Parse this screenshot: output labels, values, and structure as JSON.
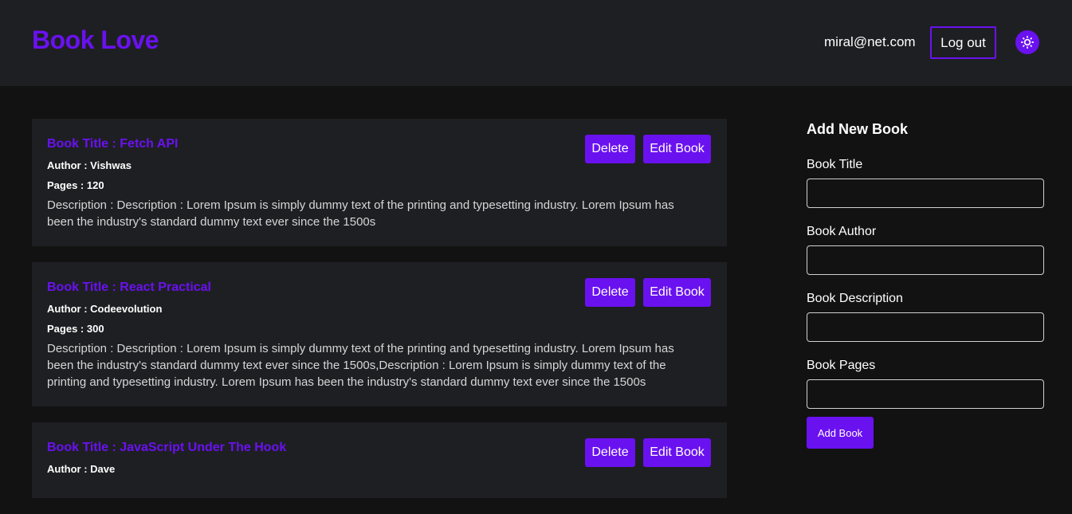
{
  "header": {
    "logo": "Book Love",
    "user_email": "miral@net.com",
    "logout_label": "Log out",
    "theme_icon": "gear-icon"
  },
  "books": [
    {
      "title": "Book Title : Fetch API",
      "author": "Author : Vishwas",
      "pages": "Pages : 120",
      "description": "Description : Description : Lorem Ipsum is simply dummy text of the printing and typesetting industry. Lorem Ipsum has been the industry's standard dummy text ever since the 1500s",
      "delete_label": "Delete",
      "edit_label": "Edit Book"
    },
    {
      "title": "Book Title : React Practical",
      "author": "Author : Codeevolution",
      "pages": "Pages : 300",
      "description": "Description : Description : Lorem Ipsum is simply dummy text of the printing and typesetting industry. Lorem Ipsum has been the industry's standard dummy text ever since the 1500s,Description : Lorem Ipsum is simply dummy text of the printing and typesetting industry. Lorem Ipsum has been the industry's standard dummy text ever since the 1500s",
      "delete_label": "Delete",
      "edit_label": "Edit Book"
    },
    {
      "title": "Book Title : JavaScript Under The Hook",
      "author": "Author : Dave",
      "pages": "",
      "description": "",
      "delete_label": "Delete",
      "edit_label": "Edit Book"
    }
  ],
  "add_form": {
    "title": "Add New Book",
    "fields": [
      {
        "label": "Book Title",
        "value": ""
      },
      {
        "label": "Book Author",
        "value": ""
      },
      {
        "label": "Book Description",
        "value": ""
      },
      {
        "label": "Book Pages",
        "value": ""
      }
    ],
    "submit_label": "Add Book"
  },
  "colors": {
    "accent": "#6a11f0",
    "header_bg": "#1e1f23",
    "page_bg": "#121212",
    "card_bg": "#1e1f23"
  }
}
